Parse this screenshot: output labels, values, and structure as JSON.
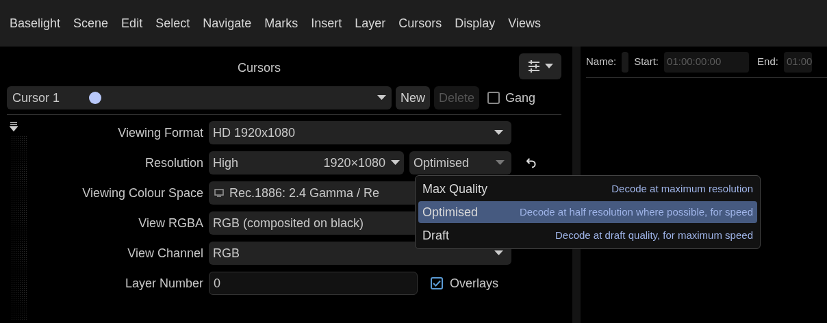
{
  "menu": [
    {
      "label": "Baselight"
    },
    {
      "label": "Scene"
    },
    {
      "label": "Edit"
    },
    {
      "label": "Select"
    },
    {
      "label": "Navigate"
    },
    {
      "label": "Marks"
    },
    {
      "label": "Insert"
    },
    {
      "label": "Layer"
    },
    {
      "label": "Cursors"
    },
    {
      "label": "Display"
    },
    {
      "label": "Views"
    }
  ],
  "cursors_panel": {
    "title": "Cursors",
    "cursor": {
      "name": "Cursor 1",
      "color": "#b8c8fa"
    },
    "buttons": [
      {
        "label": "New",
        "disabled": false
      },
      {
        "label": "Delete",
        "disabled": true
      }
    ],
    "gang": {
      "label": "Gang",
      "checked": false
    },
    "fields": [
      {
        "kind": "select",
        "label": "Viewing Format",
        "value": "HD 1920x1080"
      },
      {
        "kind": "resolution",
        "label": "Resolution",
        "value": "High",
        "size": "1920×1080",
        "mode": "Optimised"
      },
      {
        "kind": "colour",
        "label": "Viewing Colour Space",
        "value": "Rec.1886: 2.4 Gamma / Re"
      },
      {
        "kind": "short",
        "label": "View RGBA",
        "value": "RGB (composited on black)"
      },
      {
        "kind": "select",
        "label": "View Channel",
        "value": "RGB"
      },
      {
        "kind": "number",
        "label": "Layer Number",
        "value": "0"
      }
    ],
    "overlays": {
      "label": "Overlays",
      "checked": true
    },
    "mode_menu": [
      {
        "label": "Max Quality",
        "description": "Decode at maximum resolution",
        "selected": false
      },
      {
        "label": "Optimised",
        "description": "Decode at half resolution where possible, for speed",
        "selected": true
      },
      {
        "label": "Draft",
        "description": "Decode at draft quality, for maximum speed",
        "selected": false
      }
    ]
  },
  "shot_panel": {
    "name_label": "Name:",
    "start_label": "Start:",
    "start_value": "01:00:00:00",
    "end_label": "End:",
    "end_value": "01:00"
  }
}
